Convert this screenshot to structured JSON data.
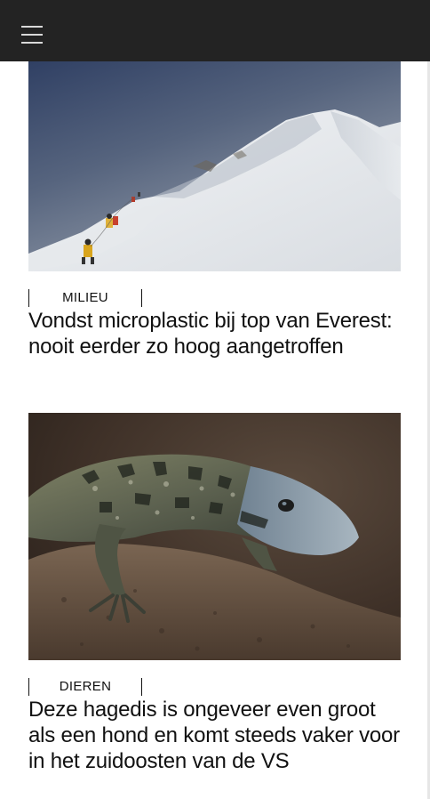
{
  "header": {
    "menu_icon": "hamburger-menu-icon"
  },
  "articles": [
    {
      "category": "MILIEU",
      "headline": "Vondst microplastic bij top van Everest: nooit eerder zo hoog aangetroffen",
      "image": "photo of climbers on snowy Everest ridge"
    },
    {
      "category": "DIEREN",
      "headline": "Deze hagedis is ongeveer even groot als een hond en komt steeds vaker voor in het zuidoosten van de VS",
      "image": "photo of a black-and-white tegu lizard on a rock"
    }
  ],
  "colors": {
    "topbar": "#232323",
    "menu_icon": "#d9d9d9",
    "text": "#111111",
    "background": "#ffffff"
  }
}
